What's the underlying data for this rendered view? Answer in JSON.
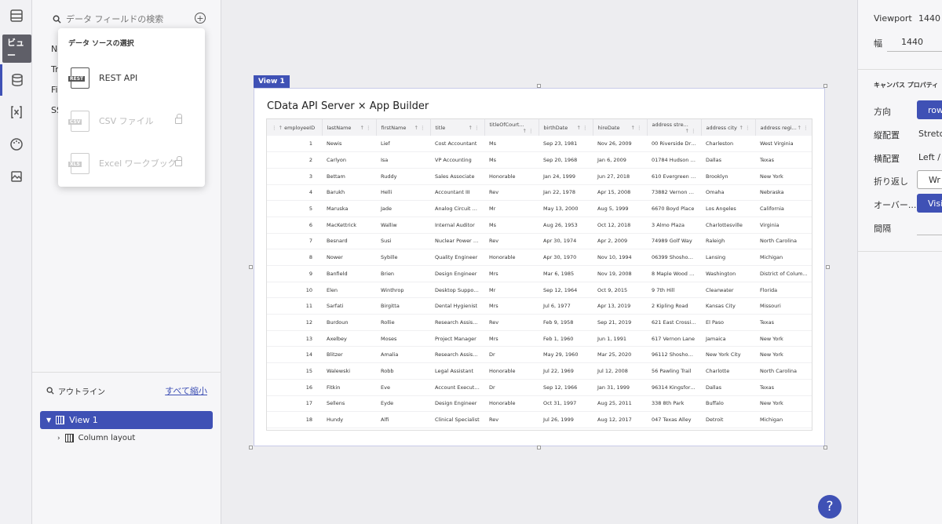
{
  "rail": {
    "tooltip": "ビュー"
  },
  "left_panel": {
    "search_placeholder": "データ フィールドの検索",
    "fields": [
      "Ne",
      "Tr",
      "Fi",
      "SS"
    ]
  },
  "popup": {
    "title": "データ ソースの選択",
    "items": [
      {
        "label": "REST API",
        "badge": "REST",
        "locked": false
      },
      {
        "label": "CSV ファイル",
        "badge": "CSV",
        "locked": true
      },
      {
        "label": "Excel ワークブック",
        "badge": "XLS",
        "locked": true
      }
    ]
  },
  "outline": {
    "title": "アウトライン",
    "collapse_all": "すべて縮小",
    "tree": {
      "root": "View 1",
      "child": "Column layout"
    }
  },
  "canvas": {
    "view_label": "View 1",
    "title": "CData API Server × App Builder",
    "grid": {
      "columns": [
        "employeeID",
        "lastName",
        "firstName",
        "title",
        "titleOfCourt...",
        "birthDate",
        "hireDate",
        "address stre...",
        "address city",
        "address regi..."
      ],
      "rows": [
        [
          "1",
          "Newis",
          "Lief",
          "Cost Accountant",
          "Ms",
          "Sep 23, 1981",
          "Nov 26, 2009",
          "00 Riverside Drive",
          "Charleston",
          "West Virginia"
        ],
        [
          "2",
          "Carlyon",
          "Isa",
          "VP Accounting",
          "Ms",
          "Sep 20, 1968",
          "Jan 6, 2009",
          "01784 Hudson T...",
          "Dallas",
          "Texas"
        ],
        [
          "3",
          "Bettam",
          "Ruddy",
          "Sales Associate",
          "Honorable",
          "Jan 24, 1999",
          "Jun 27, 2018",
          "610 Evergreen T...",
          "Brooklyn",
          "New York"
        ],
        [
          "4",
          "Barukh",
          "Helli",
          "Accountant III",
          "Rev",
          "Jan 22, 1978",
          "Apr 15, 2008",
          "73882 Vernon Cr...",
          "Omaha",
          "Nebraska"
        ],
        [
          "5",
          "Maruska",
          "Jade",
          "Analog Circuit De...",
          "Mr",
          "May 13, 2000",
          "Aug 5, 1999",
          "6670 Boyd Place",
          "Los Angeles",
          "California"
        ],
        [
          "6",
          "MacKettrick",
          "Walliw",
          "Internal Auditor",
          "Ms",
          "Aug 26, 1953",
          "Oct 12, 2018",
          "3 Almo Plaza",
          "Charlottesville",
          "Virginia"
        ],
        [
          "7",
          "Besnard",
          "Susi",
          "Nuclear Power E...",
          "Rev",
          "Apr 30, 1974",
          "Apr 2, 2009",
          "74989 Golf Way",
          "Raleigh",
          "North Carolina"
        ],
        [
          "8",
          "Nower",
          "Sybille",
          "Quality Engineer",
          "Honorable",
          "Apr 30, 1970",
          "Nov 10, 1994",
          "06399 Shoshone...",
          "Lansing",
          "Michigan"
        ],
        [
          "9",
          "Banfield",
          "Brien",
          "Design Engineer",
          "Mrs",
          "Mar 6, 1985",
          "Nov 19, 2008",
          "8 Maple Wood P...",
          "Washington",
          "District of Colum..."
        ],
        [
          "10",
          "Elen",
          "Winthrop",
          "Desktop Support...",
          "Mr",
          "Sep 12, 1964",
          "Oct 9, 2015",
          "9 7th Hill",
          "Clearwater",
          "Florida"
        ],
        [
          "11",
          "Sarfati",
          "Birgitta",
          "Dental Hygienist",
          "Mrs",
          "Jul 6, 1977",
          "Apr 13, 2019",
          "2 Kipling Road",
          "Kansas City",
          "Missouri"
        ],
        [
          "12",
          "Burdoun",
          "Rollie",
          "Research Assista...",
          "Rev",
          "Feb 9, 1958",
          "Sep 21, 2019",
          "621 East Crossing",
          "El Paso",
          "Texas"
        ],
        [
          "13",
          "Axelbey",
          "Moses",
          "Project Manager",
          "Mrs",
          "Feb 1, 1960",
          "Jun 1, 1991",
          "617 Vernon Lane",
          "Jamaica",
          "New York"
        ],
        [
          "14",
          "Blitzer",
          "Amalia",
          "Research Assista...",
          "Dr",
          "May 29, 1960",
          "Mar 25, 2020",
          "96112 Shoshone...",
          "New York City",
          "New York"
        ],
        [
          "15",
          "Walewski",
          "Robb",
          "Legal Assistant",
          "Honorable",
          "Jul 22, 1969",
          "Jul 12, 2008",
          "56 Pawling Trail",
          "Charlotte",
          "North Carolina"
        ],
        [
          "16",
          "Fitkin",
          "Eve",
          "Account Executive",
          "Dr",
          "Sep 12, 1966",
          "Jan 31, 1999",
          "96314 Kingsford...",
          "Dallas",
          "Texas"
        ],
        [
          "17",
          "Sellens",
          "Eyde",
          "Design Engineer",
          "Honorable",
          "Oct 31, 1997",
          "Aug 25, 2011",
          "338 8th Park",
          "Buffalo",
          "New York"
        ],
        [
          "18",
          "Hundy",
          "Alfi",
          "Clinical Specialist",
          "Rev",
          "Jul 26, 1999",
          "Aug 12, 2017",
          "047 Texas Alley",
          "Detroit",
          "Michigan"
        ]
      ]
    }
  },
  "right_panel": {
    "viewport_label": "Viewport",
    "viewport_value": "1440 x",
    "width_label": "幅",
    "width_value": "1440",
    "section_title": "キャンバス プロパティ",
    "direction_label": "方向",
    "direction_value": "row",
    "vertical_label": "縦配置",
    "vertical_value": "Stretch",
    "horizontal_label": "横配置",
    "horizontal_value": "Left / f",
    "wrap_label": "折り返し",
    "wrap_value": "Wr",
    "overflow_label": "オーバー...",
    "overflow_value": "Visi",
    "gap_label": "間隔"
  },
  "help": {
    "label": "?"
  },
  "colors": {
    "accent": "#3f51b5"
  }
}
